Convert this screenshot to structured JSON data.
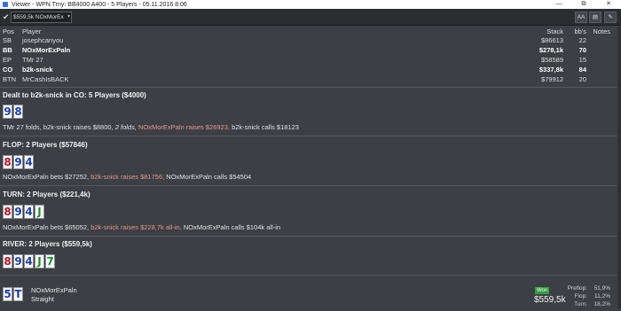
{
  "window": {
    "title": "Viewer - WPN Trny: BB4000 A400 - 5 Players - 05.11.2016 8:06",
    "minimize": "—",
    "maximize": "⧉",
    "close": "✕"
  },
  "toolbar": {
    "check_glyph": "✔",
    "hand_select_value": "$559,5k NOxMorEx",
    "dropdown_glyph": "▾",
    "font_size_label": "AA",
    "view_label": "▤",
    "edit_label": "✎"
  },
  "players": {
    "headers": {
      "pos": "Pos",
      "player": "Player",
      "stack": "Stack",
      "bbs": "bb's",
      "notes": "Notes"
    },
    "rows": [
      {
        "pos": "SB",
        "player": "josephcanyou",
        "stack": "$86613",
        "bbs": "22",
        "bold": false
      },
      {
        "pos": "BB",
        "player": "NOxMorExPaln",
        "stack": "$278,1k",
        "bbs": "70",
        "bold": true
      },
      {
        "pos": "EP",
        "player": "TMr 27",
        "stack": "$58589",
        "bbs": "15",
        "bold": false
      },
      {
        "pos": "CO",
        "player": "b2k-snick",
        "stack": "$337,8k",
        "bbs": "84",
        "bold": true
      },
      {
        "pos": "BTN",
        "player": "MrCashIsBACK",
        "stack": "$79912",
        "bbs": "20",
        "bold": false
      }
    ]
  },
  "preflop": {
    "title": "Dealt to b2k-snick in CO: 5 Players ($4000)",
    "cards": [
      {
        "rank": "9",
        "color": "#1b3fa8"
      },
      {
        "rank": "8",
        "color": "#1b3fa8"
      }
    ],
    "action_1": "TMr 27 folds, b2k-snick raises $8800,",
    "action_2": "2 folds,",
    "action_3": "NOxMorExPaln raises $26923,",
    "action_4": "b2k-snick calls $18123"
  },
  "flop": {
    "title": "FLOP: 2 Players ($57846)",
    "cards": [
      {
        "rank": "8",
        "color": "#b3152b"
      },
      {
        "rank": "9",
        "color": "#1b3fa8"
      },
      {
        "rank": "4",
        "color": "#1b3fa8"
      }
    ],
    "action_1": "NOxMorExPaln bets $27252,",
    "action_2": "b2k-snick raises $81756,",
    "action_3": "NOxMorExPaln calls $54504"
  },
  "turn": {
    "title": "TURN: 2 Players ($221,4k)",
    "cards": [
      {
        "rank": "8",
        "color": "#b3152b"
      },
      {
        "rank": "9",
        "color": "#1b3fa8"
      },
      {
        "rank": "4",
        "color": "#1b3fa8"
      },
      {
        "rank": "J",
        "color": "#1e8a2e"
      }
    ],
    "action_1": "NOxMorExPaln bets $65052,",
    "action_2": "b2k-snick raises $228,7k all-in,",
    "action_3": "NOxMorExPaln calls $104k all-in"
  },
  "river": {
    "title": "RIVER: 2 Players ($559,5k)",
    "cards": [
      {
        "rank": "8",
        "color": "#b3152b"
      },
      {
        "rank": "9",
        "color": "#1b3fa8"
      },
      {
        "rank": "4",
        "color": "#1b3fa8"
      },
      {
        "rank": "J",
        "color": "#1e8a2e"
      },
      {
        "rank": "7",
        "color": "#1e8a2e"
      }
    ]
  },
  "result": {
    "cards": [
      {
        "rank": "5",
        "color": "#1b3fa8"
      },
      {
        "rank": "T",
        "color": "#1b3fa8"
      }
    ],
    "player": "NOxMorExPaln",
    "hand": "Straight",
    "won_label": "Won",
    "won_amount": "$559,5k",
    "stats": [
      {
        "label": "Preflop:",
        "value": "51,9%"
      },
      {
        "label": "Flop:",
        "value": "11,2%"
      },
      {
        "label": "Turn:",
        "value": "18,2%"
      }
    ]
  }
}
